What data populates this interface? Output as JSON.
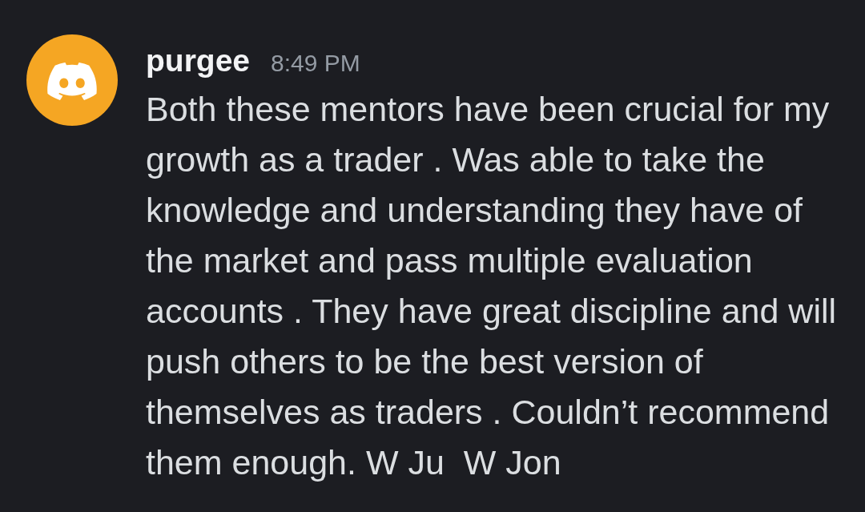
{
  "message": {
    "author": "purgee",
    "timestamp": "8:49 PM",
    "content": "Both these mentors have been crucial for my growth as a trader . Was able to take the knowledge and understanding they have of the market and pass multiple evaluation accounts . They have great discipline and will push others to be the best version of themselves as traders . Couldn’t recommend them enough. W Ju  W Jon"
  }
}
